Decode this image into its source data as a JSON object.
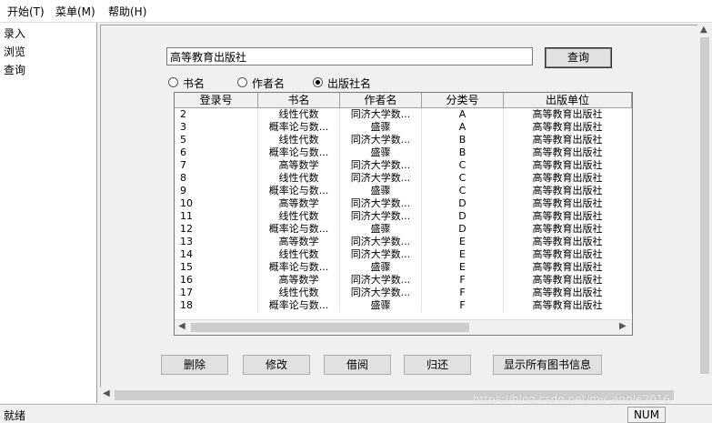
{
  "menu": {
    "items": [
      {
        "label": "开始(T)"
      },
      {
        "label": "菜单(M)"
      },
      {
        "label": "帮助(H)"
      }
    ]
  },
  "sidebar": {
    "items": [
      {
        "label": "录入"
      },
      {
        "label": "浏览"
      },
      {
        "label": "查询"
      }
    ]
  },
  "search": {
    "value": "高等教育出版社",
    "button_label": "查询"
  },
  "radios": [
    {
      "label": "书名",
      "checked": false
    },
    {
      "label": "作者名",
      "checked": false
    },
    {
      "label": "出版社名",
      "checked": true
    }
  ],
  "table": {
    "columns": [
      "登录号",
      "书名",
      "作者名",
      "分类号",
      "出版单位"
    ],
    "rows": [
      [
        "2",
        "线性代数",
        "同济大学数...",
        "A",
        "高等教育出版社"
      ],
      [
        "3",
        "概率论与数...",
        "盛骤",
        "A",
        "高等教育出版社"
      ],
      [
        "5",
        "线性代数",
        "同济大学数...",
        "B",
        "高等教育出版社"
      ],
      [
        "6",
        "概率论与数...",
        "盛骤",
        "B",
        "高等教育出版社"
      ],
      [
        "7",
        "高等数学",
        "同济大学数...",
        "C",
        "高等教育出版社"
      ],
      [
        "8",
        "线性代数",
        "同济大学数...",
        "C",
        "高等教育出版社"
      ],
      [
        "9",
        "概率论与数...",
        "盛骤",
        "C",
        "高等教育出版社"
      ],
      [
        "10",
        "高等数学",
        "同济大学数...",
        "D",
        "高等教育出版社"
      ],
      [
        "11",
        "线性代数",
        "同济大学数...",
        "D",
        "高等教育出版社"
      ],
      [
        "12",
        "概率论与数...",
        "盛骤",
        "D",
        "高等教育出版社"
      ],
      [
        "13",
        "高等数学",
        "同济大学数...",
        "E",
        "高等教育出版社"
      ],
      [
        "14",
        "线性代数",
        "同济大学数...",
        "E",
        "高等教育出版社"
      ],
      [
        "15",
        "概率论与数...",
        "盛骤",
        "E",
        "高等教育出版社"
      ],
      [
        "16",
        "高等数学",
        "同济大学数...",
        "F",
        "高等教育出版社"
      ],
      [
        "17",
        "线性代数",
        "同济大学数...",
        "F",
        "高等教育出版社"
      ],
      [
        "18",
        "概率论与数...",
        "盛骤",
        "F",
        "高等教育出版社"
      ]
    ]
  },
  "actions": {
    "delete_label": "删除",
    "modify_label": "修改",
    "borrow_label": "借阅",
    "return_label": "归还",
    "show_all_label": "显示所有图书信息"
  },
  "status": {
    "text": "就绪",
    "num_indicator": "NUM"
  },
  "watermark": "https://blog.csdn.net/my_angle2016"
}
